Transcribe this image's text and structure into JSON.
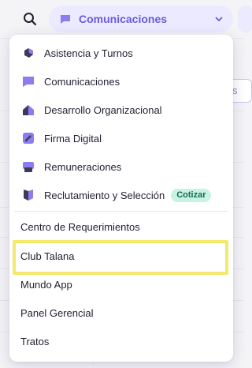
{
  "header": {
    "search_icon": "search-icon",
    "module_select": {
      "label": "Comunicaciones",
      "icon": "chat-icon"
    }
  },
  "dropdown": {
    "modules": [
      {
        "label": "Asistencia y Turnos",
        "icon": "shift-icon"
      },
      {
        "label": "Comunicaciones",
        "icon": "chat-icon"
      },
      {
        "label": "Desarrollo Organizacional",
        "icon": "building-icon"
      },
      {
        "label": "Firma Digital",
        "icon": "pen-icon"
      },
      {
        "label": "Remuneraciones",
        "icon": "payroll-icon"
      },
      {
        "label": "Reclutamiento y Selección",
        "icon": "flag-icon",
        "badge": "Cotizar"
      }
    ],
    "links": [
      {
        "label": "Centro de Requerimientos"
      },
      {
        "label": "Club Talana"
      },
      {
        "label": "Mundo App"
      },
      {
        "label": "Panel Gerencial"
      },
      {
        "label": "Tratos"
      }
    ]
  },
  "background": {
    "tab_fragment": "s"
  },
  "colors": {
    "accent": "#6a5cd8",
    "icon_purple": "#8b7cf0",
    "icon_dark": "#3c3a57",
    "select_bg": "#eceaff",
    "badge_bg": "#c8f3e4",
    "highlight": "#f3e96d"
  }
}
